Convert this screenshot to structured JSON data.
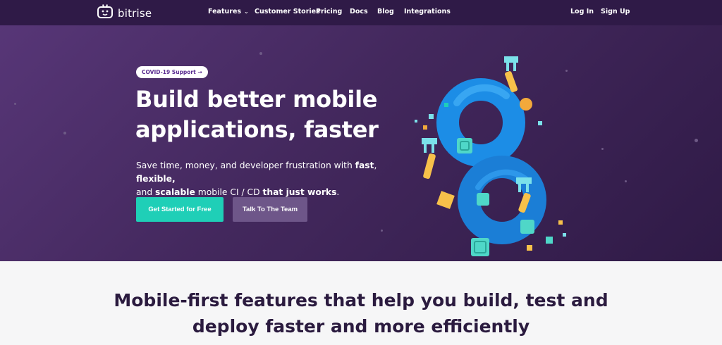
{
  "nav": {
    "logo_text": "bitrise",
    "features": "Features",
    "customer_stories": "Customer Stories",
    "pricing": "Pricing",
    "docs": "Docs",
    "blog": "Blog",
    "integrations": "Integrations",
    "login": "Log In",
    "signup": "Sign Up"
  },
  "hero": {
    "covid_pill": "COVID-19 Support →",
    "headline": "Build better mobile applications, faster",
    "sub_part1": "Save time, money, and developer frustration with ",
    "sub_fast": "fast",
    "sub_comma": ", ",
    "sub_flexible": "flexible,",
    "sub_and": "and ",
    "sub_scalable": "scalable",
    "sub_part2": " mobile CI / CD ",
    "sub_works": "that just works",
    "sub_end": ".",
    "cta_primary": "Get Started for Free",
    "cta_secondary": "Talk To The Team"
  },
  "features": {
    "title_line1": "Mobile-first features that help you build, test and",
    "title_line2": "deploy faster and more efficiently"
  },
  "colors": {
    "nav_bg": "#2f1a47",
    "hero_bg_start": "#573677",
    "hero_bg_end": "#2f1a46",
    "primary_btn": "#1fcfb7",
    "secondary_btn": "#6e5689",
    "accent_purple": "#5a2c91",
    "eight_blue": "#1c8de6",
    "robot_arm": "#7be1ea",
    "gear_yellow": "#f7c14a"
  },
  "icons": [
    "bitrise-robot-logo-icon",
    "chevron-down-icon",
    "infinity-eight-illustration-icon"
  ]
}
